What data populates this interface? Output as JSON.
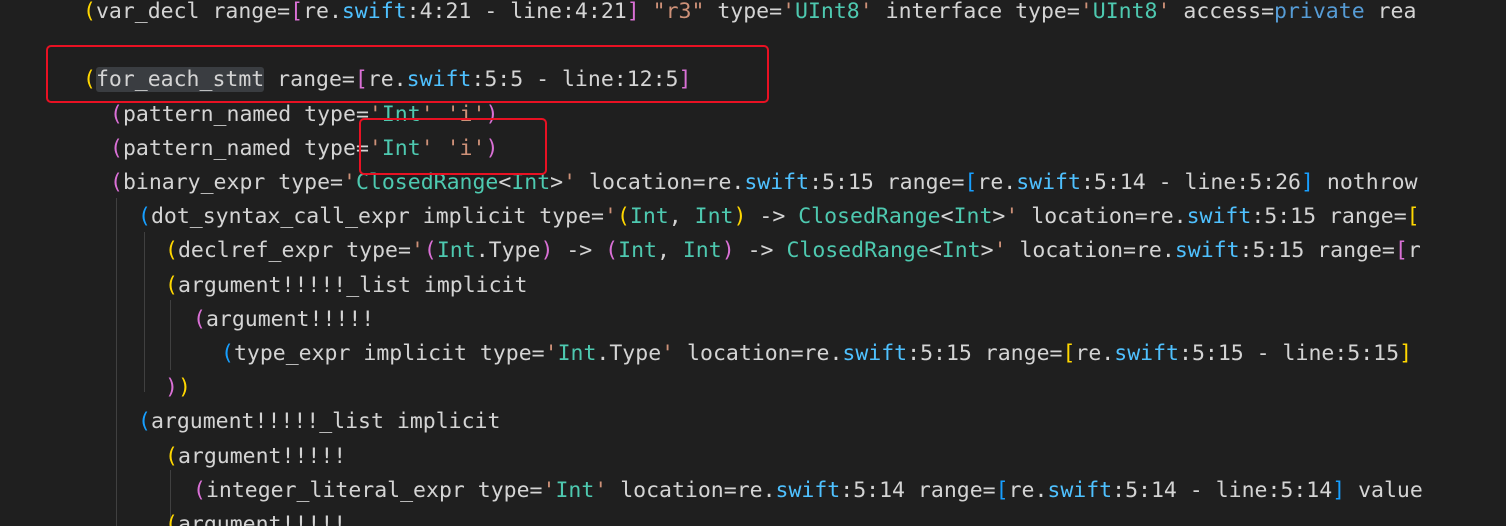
{
  "lines": [
    [
      [
        "br-1",
        "("
      ],
      [
        "tok-plain",
        "var_decl range="
      ],
      [
        "br-2",
        "["
      ],
      [
        "tok-plain",
        "re."
      ],
      [
        "tok-swift",
        "swift"
      ],
      [
        "tok-plain",
        ":4:21 - line:4:21"
      ],
      [
        "br-2",
        "]"
      ],
      [
        "tok-plain",
        " "
      ],
      [
        "tok-string",
        "\"r3\""
      ],
      [
        "tok-plain",
        " type="
      ],
      [
        "tok-string",
        "'"
      ],
      [
        "tok-type",
        "UInt8"
      ],
      [
        "tok-string",
        "'"
      ],
      [
        "tok-plain",
        " interface type="
      ],
      [
        "tok-string",
        "'"
      ],
      [
        "tok-type",
        "UInt8"
      ],
      [
        "tok-string",
        "'"
      ],
      [
        "tok-plain",
        " access="
      ],
      [
        "tok-keyword",
        "private"
      ],
      [
        "tok-plain",
        " rea"
      ]
    ],
    [],
    [
      [
        "br-1",
        "("
      ],
      [
        "sel",
        "for_each_stmt"
      ],
      [
        "tok-plain",
        " range="
      ],
      [
        "br-2",
        "["
      ],
      [
        "tok-plain",
        "re."
      ],
      [
        "tok-swift",
        "swift"
      ],
      [
        "tok-plain",
        ":5:5 - line:12:5"
      ],
      [
        "br-2",
        "]"
      ]
    ],
    [
      [
        "br-2",
        "("
      ],
      [
        "tok-plain",
        "pattern_named type="
      ],
      [
        "tok-string",
        "'"
      ],
      [
        "tok-type",
        "Int"
      ],
      [
        "tok-string",
        "'"
      ],
      [
        "tok-plain",
        " "
      ],
      [
        "tok-string",
        "'i'"
      ],
      [
        "br-2",
        ")"
      ]
    ],
    [
      [
        "br-2",
        "("
      ],
      [
        "tok-plain",
        "pattern_named type="
      ],
      [
        "tok-string",
        "'"
      ],
      [
        "tok-type",
        "Int"
      ],
      [
        "tok-string",
        "'"
      ],
      [
        "tok-plain",
        " "
      ],
      [
        "tok-string",
        "'i'"
      ],
      [
        "br-2",
        ")"
      ]
    ],
    [
      [
        "br-2",
        "("
      ],
      [
        "tok-plain",
        "binary_expr type="
      ],
      [
        "tok-string",
        "'"
      ],
      [
        "tok-type",
        "ClosedRange"
      ],
      [
        "tok-plain",
        "<"
      ],
      [
        "tok-type",
        "Int"
      ],
      [
        "tok-plain",
        ">"
      ],
      [
        "tok-string",
        "'"
      ],
      [
        "tok-plain",
        " location=re."
      ],
      [
        "tok-swift",
        "swift"
      ],
      [
        "tok-plain",
        ":5:15 range="
      ],
      [
        "br-3",
        "["
      ],
      [
        "tok-plain",
        "re."
      ],
      [
        "tok-swift",
        "swift"
      ],
      [
        "tok-plain",
        ":5:14 - line:5:26"
      ],
      [
        "br-3",
        "]"
      ],
      [
        "tok-plain",
        " nothrow"
      ]
    ],
    [
      [
        "br-3",
        "("
      ],
      [
        "tok-plain",
        "dot_syntax_call_expr implicit type="
      ],
      [
        "tok-string",
        "'"
      ],
      [
        "br-1",
        "("
      ],
      [
        "tok-type",
        "Int"
      ],
      [
        "tok-plain",
        ", "
      ],
      [
        "tok-type",
        "Int"
      ],
      [
        "br-1",
        ")"
      ],
      [
        "tok-plain",
        " -> "
      ],
      [
        "tok-type",
        "ClosedRange"
      ],
      [
        "tok-plain",
        "<"
      ],
      [
        "tok-type",
        "Int"
      ],
      [
        "tok-plain",
        ">"
      ],
      [
        "tok-string",
        "'"
      ],
      [
        "tok-plain",
        " location=re."
      ],
      [
        "tok-swift",
        "swift"
      ],
      [
        "tok-plain",
        ":5:15 range="
      ],
      [
        "br-1",
        "["
      ]
    ],
    [
      [
        "br-1",
        "("
      ],
      [
        "tok-plain",
        "declref_expr type="
      ],
      [
        "tok-string",
        "'"
      ],
      [
        "br-2",
        "("
      ],
      [
        "tok-type",
        "Int"
      ],
      [
        "tok-plain",
        ".Type"
      ],
      [
        "br-2",
        ")"
      ],
      [
        "tok-plain",
        " -> "
      ],
      [
        "br-2",
        "("
      ],
      [
        "tok-type",
        "Int"
      ],
      [
        "tok-plain",
        ", "
      ],
      [
        "tok-type",
        "Int"
      ],
      [
        "br-2",
        ")"
      ],
      [
        "tok-plain",
        " -> "
      ],
      [
        "tok-type",
        "ClosedRange"
      ],
      [
        "tok-plain",
        "<"
      ],
      [
        "tok-type",
        "Int"
      ],
      [
        "tok-plain",
        ">"
      ],
      [
        "tok-string",
        "'"
      ],
      [
        "tok-plain",
        " location=re."
      ],
      [
        "tok-swift",
        "swift"
      ],
      [
        "tok-plain",
        ":5:15 range="
      ],
      [
        "br-2",
        "["
      ],
      [
        "tok-plain",
        "r"
      ]
    ],
    [
      [
        "br-1",
        "("
      ],
      [
        "tok-plain",
        "argument!!!!!_list implicit"
      ]
    ],
    [
      [
        "br-2",
        "("
      ],
      [
        "tok-plain",
        "argument!!!!!"
      ]
    ],
    [
      [
        "br-3",
        "("
      ],
      [
        "tok-plain",
        "type_expr implicit type="
      ],
      [
        "tok-string",
        "'"
      ],
      [
        "tok-type",
        "Int"
      ],
      [
        "tok-plain",
        ".Type"
      ],
      [
        "tok-string",
        "'"
      ],
      [
        "tok-plain",
        " location=re."
      ],
      [
        "tok-swift",
        "swift"
      ],
      [
        "tok-plain",
        ":5:15 range="
      ],
      [
        "br-1",
        "["
      ],
      [
        "tok-plain",
        "re."
      ],
      [
        "tok-swift",
        "swift"
      ],
      [
        "tok-plain",
        ":5:15 - line:5:15"
      ],
      [
        "br-1",
        "]"
      ]
    ],
    [
      [
        "br-2",
        ")"
      ],
      [
        "br-1",
        ")"
      ]
    ],
    [
      [
        "br-3",
        "("
      ],
      [
        "tok-plain",
        "argument!!!!!_list implicit"
      ]
    ],
    [
      [
        "br-1",
        "("
      ],
      [
        "tok-plain",
        "argument!!!!!"
      ]
    ],
    [
      [
        "br-2",
        "("
      ],
      [
        "tok-plain",
        "integer_literal_expr type="
      ],
      [
        "tok-string",
        "'"
      ],
      [
        "tok-type",
        "Int"
      ],
      [
        "tok-string",
        "'"
      ],
      [
        "tok-plain",
        " location=re."
      ],
      [
        "tok-swift",
        "swift"
      ],
      [
        "tok-plain",
        ":5:14 range="
      ],
      [
        "br-3",
        "["
      ],
      [
        "tok-plain",
        "re."
      ],
      [
        "tok-swift",
        "swift"
      ],
      [
        "tok-plain",
        ":5:14 - line:5:14"
      ],
      [
        "br-3",
        "]"
      ],
      [
        "tok-plain",
        " value"
      ]
    ],
    [
      [
        "br-1",
        "("
      ],
      [
        "tok-plain",
        "argument!!!!!"
      ]
    ]
  ]
}
